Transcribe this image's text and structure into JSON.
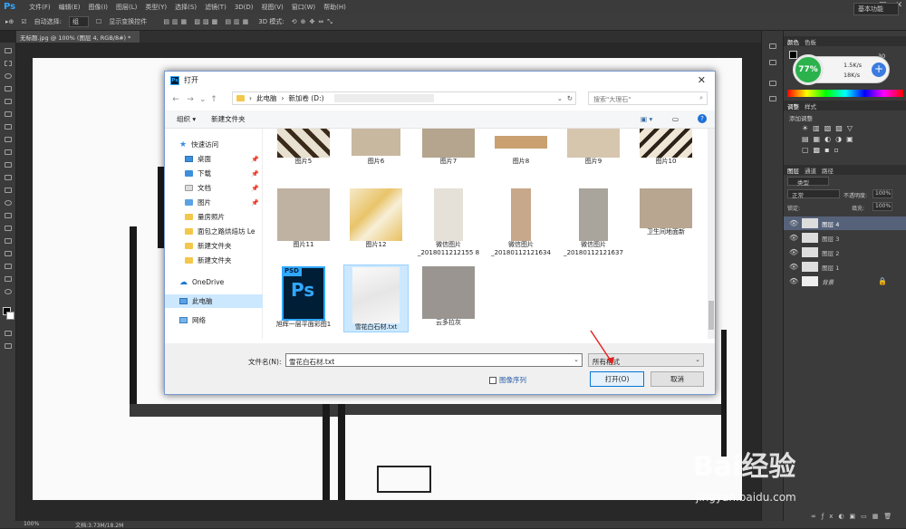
{
  "ps": {
    "logo": "Ps",
    "menu": [
      "文件(F)",
      "编辑(E)",
      "图像(I)",
      "图层(L)",
      "类型(Y)",
      "选择(S)",
      "滤镜(T)",
      "3D(D)",
      "视图(V)",
      "窗口(W)",
      "帮助(H)"
    ],
    "options": {
      "auto_select": "自动选择:",
      "auto_select_value": "组",
      "show_transform": "显示变换控件",
      "mode3d": "3D 模式:"
    },
    "workspace": "基本功能",
    "doc_tab": "无标题.jpg @ 100% (图层 4, RGB/8#) *",
    "status_zoom": "100%",
    "status_doc": "文档:3.73M/18.2M",
    "right_tabs": {
      "color": "颜色",
      "swatches": "色板",
      "adjust": "调整",
      "styles": "样式",
      "add_adjust": "添加调整",
      "layers": "图层",
      "channels": "通道",
      "paths": "路径"
    },
    "layers_controls": {
      "kind": "类型",
      "blend": "正常",
      "opacity_label": "不透明度:",
      "opacity": "100%",
      "lock": "锁定:",
      "fill_label": "填充:",
      "fill": "100%"
    },
    "layers": [
      "图层 4",
      "图层 3",
      "图层 2",
      "图层 1",
      "背景"
    ],
    "gauge": {
      "percent": "77%",
      "up": "1.5K/s",
      "down": "18K/s"
    },
    "ruler_value": "30"
  },
  "dialog": {
    "title": "打开",
    "breadcrumb": [
      "此电脑",
      "新加卷 (D:)"
    ],
    "search_placeholder": "搜索\"大理石\"",
    "organize": "组织 ▾",
    "new_folder": "新建文件夹",
    "nav": {
      "quick_access": "快速访问",
      "items": [
        "桌面",
        "下载",
        "文档",
        "图片",
        "量房照片",
        "面包之路烘焙坊  Le",
        "新建文件夹",
        "新建文件夹"
      ],
      "onedrive": "OneDrive",
      "this_pc": "此电脑",
      "network": "网络"
    },
    "files_row1": [
      "图片5",
      "图片6",
      "图片7",
      "图片8",
      "图片9",
      "图片10"
    ],
    "files_row2": [
      "图片11",
      "图片12",
      "微信图片_2018011212155 8",
      "微信图片_20180112121634",
      "微信图片_20180112121637",
      "卫生间地面新"
    ],
    "files_row3": [
      "旭辉一层平面彩图1",
      "雪花白石材.txt",
      "云多拉灰"
    ],
    "psd_badge": "PSD",
    "psd_letters": "Ps",
    "filename_label": "文件名(N):",
    "filename_value": "雪花白石材.txt",
    "filter_value": "所有格式",
    "image_sequence": "图像序列",
    "open_button": "打开(O)",
    "cancel_button": "取消"
  },
  "watermark": {
    "brand": "Bai经验",
    "url": "jingyan.baidu.com"
  }
}
